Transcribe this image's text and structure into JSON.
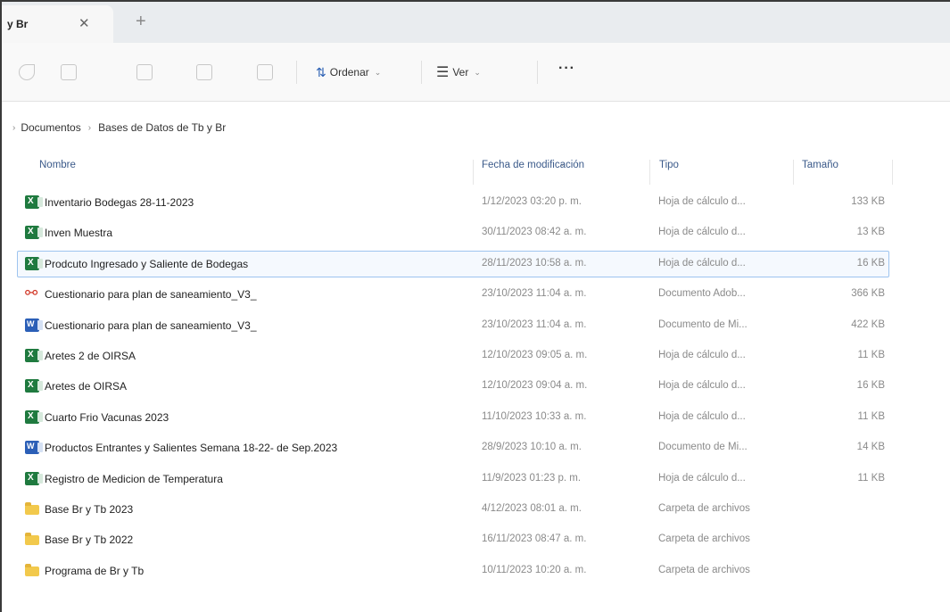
{
  "tab": {
    "title": "y Br",
    "close_glyph": "✕",
    "new_glyph": "+"
  },
  "toolbar": {
    "icons": [
      "cut-icon",
      "copy-icon",
      "paste-icon",
      "rename-icon",
      "delete-icon"
    ],
    "sort_label": "Ordenar",
    "sort_glyph": "⇅",
    "view_label": "Ver",
    "view_glyph": "☰",
    "chevron": "⌄",
    "more_label": "···"
  },
  "breadcrumb": {
    "lead_glyph": "›",
    "separator": "›",
    "items": [
      "Documentos",
      "Bases de Datos de Tb y Br"
    ]
  },
  "columns": {
    "name": "Nombre",
    "date": "Fecha de modificación",
    "type": "Tipo",
    "size": "Tamaño",
    "sort_caret": "⌄"
  },
  "files": [
    {
      "name": "Inventario Bodegas 28-11-2023",
      "date": "1/12/2023 03:20 p. m.",
      "type": "Hoja de cálculo d...",
      "size": "133 KB",
      "icon": "excel"
    },
    {
      "name": "Inven Muestra",
      "date": "30/11/2023 08:42 a. m.",
      "type": "Hoja de cálculo d...",
      "size": "13 KB",
      "icon": "excel"
    },
    {
      "name": "Prodcuto Ingresado y Saliente de Bodegas",
      "date": "28/11/2023 10:58 a. m.",
      "type": "Hoja de cálculo d...",
      "size": "16 KB",
      "icon": "excel"
    },
    {
      "name": "Cuestionario para plan de saneamiento_V3_",
      "date": "23/10/2023 11:04 a. m.",
      "type": "Documento Adob...",
      "size": "366 KB",
      "icon": "pdf"
    },
    {
      "name": "Cuestionario para plan de saneamiento_V3_",
      "date": "23/10/2023 11:04 a. m.",
      "type": "Documento de Mi...",
      "size": "422 KB",
      "icon": "word"
    },
    {
      "name": "Aretes 2 de OIRSA",
      "date": "12/10/2023 09:05 a. m.",
      "type": "Hoja de cálculo d...",
      "size": "11 KB",
      "icon": "excel"
    },
    {
      "name": "Aretes de OIRSA",
      "date": "12/10/2023 09:04 a. m.",
      "type": "Hoja de cálculo d...",
      "size": "16 KB",
      "icon": "excel"
    },
    {
      "name": "Cuarto Frio Vacunas 2023",
      "date": "11/10/2023 10:33 a. m.",
      "type": "Hoja de cálculo d...",
      "size": "11 KB",
      "icon": "excel"
    },
    {
      "name": "Productos Entrantes y Salientes Semana 18-22- de Sep.2023",
      "date": "28/9/2023 10:10 a. m.",
      "type": "Documento de Mi...",
      "size": "14 KB",
      "icon": "word"
    },
    {
      "name": "Registro de Medicion de Temperatura",
      "date": "11/9/2023 01:23 p. m.",
      "type": "Hoja de cálculo d...",
      "size": "11 KB",
      "icon": "excel"
    },
    {
      "name": "Base Br y Tb 2023",
      "date": "4/12/2023 08:01 a. m.",
      "type": "Carpeta de archivos",
      "size": "",
      "icon": "folder"
    },
    {
      "name": "Base Br y Tb 2022",
      "date": "16/11/2023 08:47 a. m.",
      "type": "Carpeta de archivos",
      "size": "",
      "icon": "folder"
    },
    {
      "name": "Programa de Br y Tb",
      "date": "10/11/2023 10:20 a. m.",
      "type": "Carpeta de archivos",
      "size": "",
      "icon": "folder"
    }
  ],
  "selected_index": 2
}
